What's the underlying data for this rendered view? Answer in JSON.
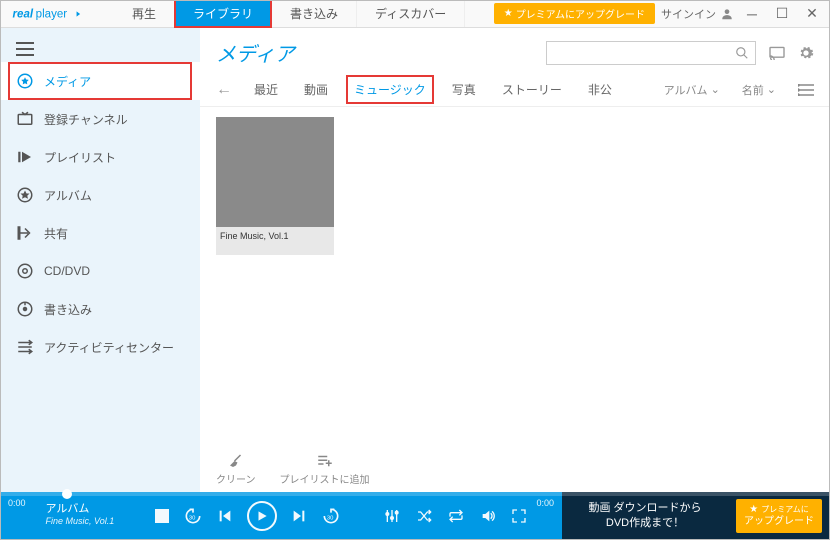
{
  "app_name": "realplayer",
  "tabs": [
    {
      "label": "再生",
      "active": false,
      "highlighted": false
    },
    {
      "label": "ライブラリ",
      "active": true,
      "highlighted": true
    },
    {
      "label": "書き込み",
      "active": false,
      "highlighted": false
    },
    {
      "label": "ディスカバー",
      "active": false,
      "highlighted": false
    }
  ],
  "titlebar": {
    "premium_label": "プレミアムにアップグレード",
    "signin_label": "サインイン"
  },
  "sidebar": {
    "items": [
      {
        "icon": "star-circle",
        "label": "メディア",
        "active": true,
        "highlighted": true
      },
      {
        "icon": "tv",
        "label": "登録チャンネル",
        "active": false,
        "highlighted": false
      },
      {
        "icon": "playlist",
        "label": "プレイリスト",
        "active": false,
        "highlighted": false
      },
      {
        "icon": "album",
        "label": "アルバム",
        "active": false,
        "highlighted": false
      },
      {
        "icon": "share",
        "label": "共有",
        "active": false,
        "highlighted": false
      },
      {
        "icon": "disc",
        "label": "CD/DVD",
        "active": false,
        "highlighted": false
      },
      {
        "icon": "burn",
        "label": "書き込み",
        "active": false,
        "highlighted": false
      },
      {
        "icon": "activity",
        "label": "アクティビティセンター",
        "active": false,
        "highlighted": false
      }
    ]
  },
  "header": {
    "title": "メディア",
    "search_placeholder": ""
  },
  "filters": [
    {
      "label": "最近",
      "active": false,
      "highlighted": false
    },
    {
      "label": "動画",
      "active": false,
      "highlighted": false
    },
    {
      "label": "ミュージック",
      "active": true,
      "highlighted": true
    },
    {
      "label": "写真",
      "active": false,
      "highlighted": false
    },
    {
      "label": "ストーリー",
      "active": false,
      "highlighted": false
    },
    {
      "label": "非公",
      "active": false,
      "highlighted": false
    }
  ],
  "filter_right": {
    "group_label": "アルバム",
    "sort_label": "名前"
  },
  "albums": [
    {
      "title": "Fine Music, Vol.1"
    }
  ],
  "tools": {
    "cleanup": "クリーン",
    "add_playlist": "プレイリストに追加"
  },
  "player": {
    "time_start": "0:00",
    "time_end": "0:00",
    "now_playing_title": "アルバム",
    "now_playing_subtitle": "Fine Music, Vol.1"
  },
  "promo": {
    "line1": "動画 ダウンロードから",
    "line2": "DVD作成まで！",
    "btn_line1": "プレミアムに",
    "btn_line2": "アップグレード"
  }
}
